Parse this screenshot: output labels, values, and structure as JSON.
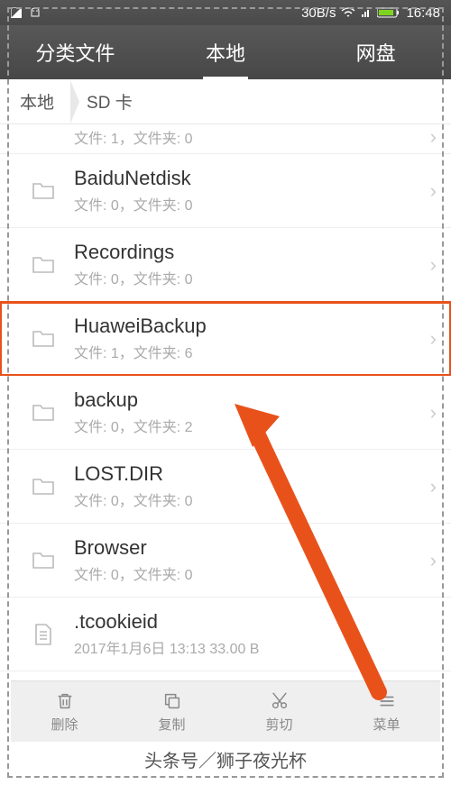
{
  "status_bar": {
    "speed": "30B/s",
    "time": "16:48"
  },
  "tabs": [
    {
      "label": "分类文件",
      "active": false
    },
    {
      "label": "本地",
      "active": true
    },
    {
      "label": "网盘",
      "active": false
    }
  ],
  "breadcrumb": [
    {
      "label": "本地"
    },
    {
      "label": "SD 卡"
    }
  ],
  "partial_item": {
    "meta": "文件: 1，文件夹: 0"
  },
  "items": [
    {
      "name": "BaiduNetdisk",
      "meta": "文件: 0，文件夹: 0",
      "type": "folder",
      "highlighted": false
    },
    {
      "name": "Recordings",
      "meta": "文件: 0，文件夹: 0",
      "type": "folder",
      "highlighted": false
    },
    {
      "name": "HuaweiBackup",
      "meta": "文件: 1，文件夹: 6",
      "type": "folder",
      "highlighted": true
    },
    {
      "name": "backup",
      "meta": "文件: 0，文件夹: 2",
      "type": "folder",
      "highlighted": false
    },
    {
      "name": "LOST.DIR",
      "meta": "文件: 0，文件夹: 0",
      "type": "folder",
      "highlighted": false
    },
    {
      "name": "Browser",
      "meta": "文件: 0，文件夹: 0",
      "type": "folder",
      "highlighted": false
    },
    {
      "name": ".tcookieid",
      "meta": "2017年1月6日 13:13 33.00 B",
      "type": "file",
      "highlighted": false
    }
  ],
  "toolbar": [
    {
      "label": "删除",
      "icon": "trash"
    },
    {
      "label": "复制",
      "icon": "copy"
    },
    {
      "label": "剪切",
      "icon": "cut"
    },
    {
      "label": "菜单",
      "icon": "menu"
    }
  ],
  "watermark": "头条号／狮子夜光杯"
}
